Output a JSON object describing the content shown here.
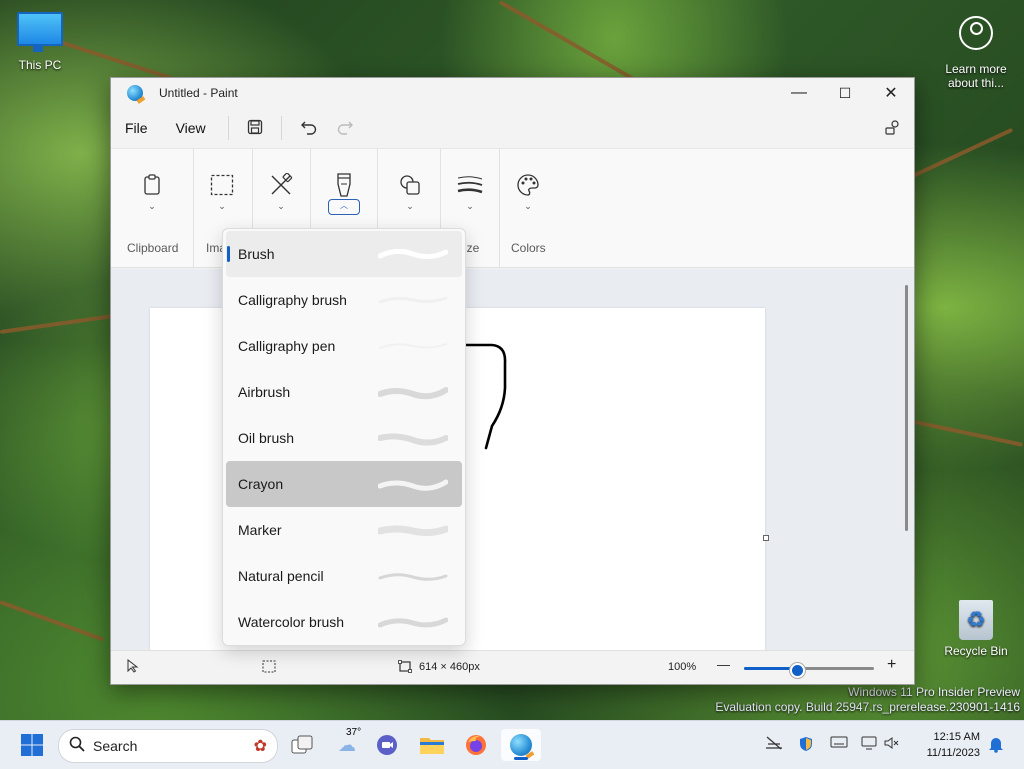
{
  "desktop": {
    "this_pc_label": "This PC",
    "learn_label": "Learn more about thi...",
    "recycle_label": "Recycle Bin",
    "watermark_line1": "Windows 11 Pro Insider Preview",
    "watermark_line2": "Evaluation copy. Build 25947.rs_prerelease.230901-1416"
  },
  "window": {
    "title": "Untitled - Paint",
    "min_glyph": "—",
    "max_glyph": "☐",
    "close_glyph": "✕"
  },
  "menu": {
    "file": "File",
    "view": "View"
  },
  "toolbar": {
    "clipboard_label": "Clipboard",
    "image_label_partial": "Ima",
    "size_label_partial": "ize",
    "colors_label": "Colors"
  },
  "brushes": {
    "items": [
      {
        "label": "Brush"
      },
      {
        "label": "Calligraphy brush"
      },
      {
        "label": "Calligraphy pen"
      },
      {
        "label": "Airbrush"
      },
      {
        "label": "Oil brush"
      },
      {
        "label": "Crayon"
      },
      {
        "label": "Marker"
      },
      {
        "label": "Natural pencil"
      },
      {
        "label": "Watercolor brush"
      }
    ],
    "selected": "Brush",
    "hovered": "Crayon"
  },
  "status": {
    "canvas_size": "614 × 460px",
    "zoom": "100%",
    "zoom_minus": "—",
    "zoom_plus": "+",
    "zoom_level": 0.4
  },
  "taskbar": {
    "search_label": "Search",
    "weather_temp": "37°",
    "time": "12:15 AM",
    "date": "11/11/2023"
  },
  "colors": {
    "accent": "#1060c8"
  }
}
